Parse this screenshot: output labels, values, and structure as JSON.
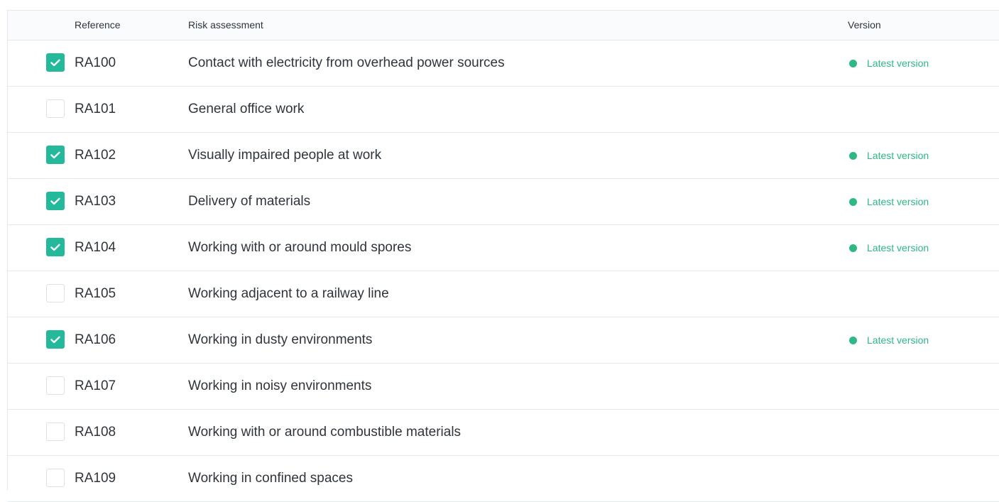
{
  "table": {
    "headers": {
      "reference": "Reference",
      "risk_assessment": "Risk assessment",
      "version": "Version"
    },
    "rows": [
      {
        "reference": "RA100",
        "risk_assessment": "Contact with electricity from overhead power sources",
        "checked": true,
        "version": "Latest version"
      },
      {
        "reference": "RA101",
        "risk_assessment": "General office work",
        "checked": false,
        "version": ""
      },
      {
        "reference": "RA102",
        "risk_assessment": "Visually impaired people at work",
        "checked": true,
        "version": "Latest version"
      },
      {
        "reference": "RA103",
        "risk_assessment": "Delivery of materials",
        "checked": true,
        "version": "Latest version"
      },
      {
        "reference": "RA104",
        "risk_assessment": "Working with or around mould spores",
        "checked": true,
        "version": "Latest version"
      },
      {
        "reference": "RA105",
        "risk_assessment": "Working adjacent to a railway line",
        "checked": false,
        "version": ""
      },
      {
        "reference": "RA106",
        "risk_assessment": "Working in dusty environments",
        "checked": true,
        "version": "Latest version"
      },
      {
        "reference": "RA107",
        "risk_assessment": "Working in noisy environments",
        "checked": false,
        "version": ""
      },
      {
        "reference": "RA108",
        "risk_assessment": "Working with or around combustible materials",
        "checked": false,
        "version": ""
      },
      {
        "reference": "RA109",
        "risk_assessment": "Working in confined spaces",
        "checked": false,
        "version": ""
      }
    ]
  },
  "colors": {
    "accent": "#23b99a",
    "status_green": "#2eb884",
    "border": "#e4e7eb"
  },
  "icons": {
    "checkbox_mark": "check-icon",
    "status": "status-dot-icon"
  }
}
